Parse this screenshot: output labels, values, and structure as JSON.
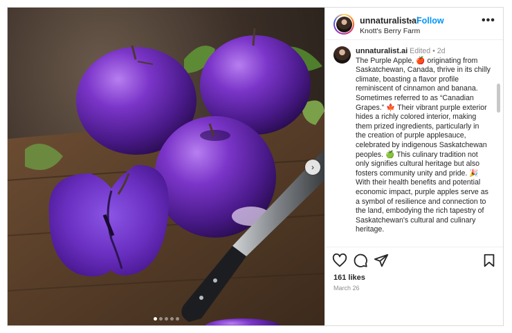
{
  "post": {
    "username": "unnaturalist.ai",
    "separator": "•",
    "follow_label": "Follow",
    "location": "Knott's Berry Farm",
    "more_glyph": "•••",
    "image_count": 5,
    "current_image": 1,
    "next_glyph": "›"
  },
  "caption": {
    "username": "unnaturalist.ai",
    "meta": "Edited • 2d",
    "p1": "The Purple Apple,",
    "emoji_apple": "🍎",
    "p2": "originating from Saskatchewan, Canada, thrive in its chilly climate, boasting a flavor profile reminiscent of cinnamon and banana. Sometimes referred to as “Canadian Grapes.”",
    "emoji_leaf": "🍁",
    "p3": "Their vibrant purple exterior hides a richly colored interior, making them prized ingredients, particularly in the creation of purple applesauce, celebrated by indigenous Saskatchewan peoples.",
    "emoji_green_apple": "🍏",
    "p4": "This culinary tradition not only signifies cultural heritage but also fosters community unity and pride.",
    "emoji_party": "🎉",
    "p5": "With their health benefits and potential economic impact, purple apples serve as a symbol of resilience and connection to the land, embodying the rich tapestry of Saskatchewan's cultural and culinary heritage."
  },
  "engagement": {
    "likes": "161 likes",
    "date": "March 26"
  },
  "icons": {
    "like": "heart-icon",
    "comment": "comment-icon",
    "share": "send-icon",
    "save": "bookmark-icon"
  },
  "colors": {
    "link": "#0095f6",
    "text": "#262626",
    "muted": "#8e8e8e",
    "apple": "#6a2fb0"
  }
}
